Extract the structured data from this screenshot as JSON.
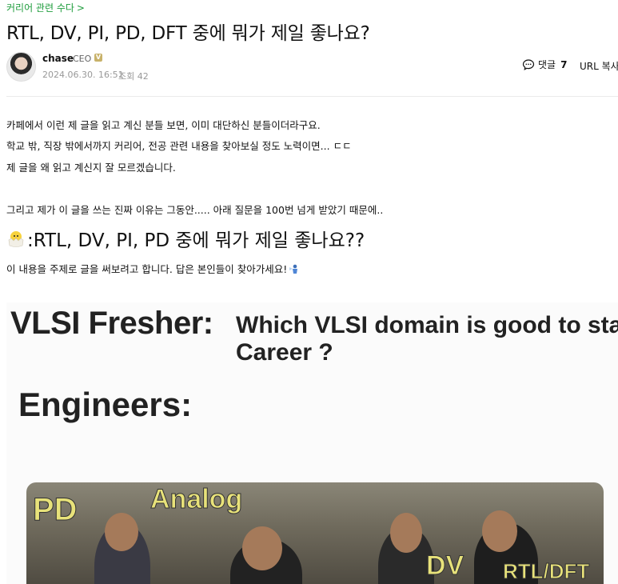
{
  "breadcrumb": {
    "label": "커리어 관련 수다",
    "chevron": ">"
  },
  "post": {
    "title": "RTL, DV, PI, PD, DFT 중에 뭐가 제일 좋나요?",
    "author": {
      "name": "chase",
      "role": "CEO",
      "badge": "V"
    },
    "date": "2024.06.30. 16:51",
    "views": "조회 42",
    "comments_label": "댓글",
    "comments_count": "7",
    "url_copy": "URL 복사"
  },
  "body": {
    "line1": "카페에서 이런 제 글을 읽고 계신 분들 보면, 이미 대단하신 분들이더라구요.",
    "line2": "학교 밖, 직장 밖에서까지 커리어, 전공 관련 내용을 찾아보실 정도 노력이면... ㄷㄷ",
    "line3": "제 글을 왜 읽고 계신지 잘 모르겠습니다.",
    "line4": "그리고 제가 이 글을 쓰는 진짜 이유는 그동안..... 아래 질문을 100번 넘게 받았기 때문에..",
    "subheading": ":RTL, DV, PI, PD 중에 뭐가 제일 좋나요??",
    "intro": "이 내용을 주제로 글을 써보려고 합니다. 답은 본인들이 찾아가세요!"
  },
  "meme": {
    "fresher": "VLSI Fresher:",
    "question_line1": "Which VLSI domain is good to start",
    "question_line2": "Career ?",
    "engineers": "Engineers:",
    "labels": {
      "pd": "PD",
      "analog": "Analog",
      "dv": "DV",
      "rtl": "RTL/DFT"
    }
  },
  "colors": {
    "breadcrumb": "#1f9d3d",
    "meta": "#999999",
    "divider": "#ebebeb"
  }
}
